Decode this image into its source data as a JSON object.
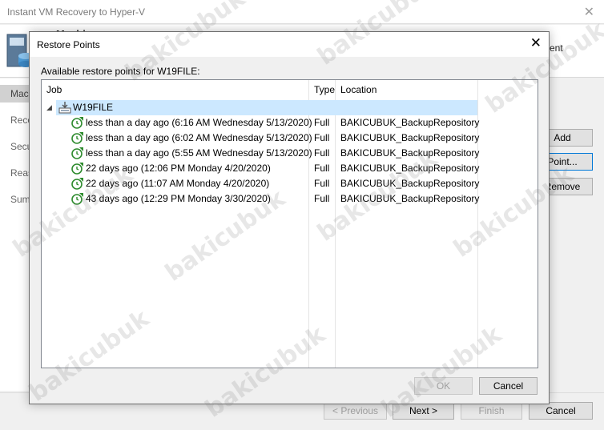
{
  "wizard": {
    "title": "Instant VM Recovery to Hyper-V",
    "header_title": "Machines",
    "header_desc_tail": "ent",
    "steps": [
      "Machines",
      "Recovery Mode",
      "Secure Restore",
      "Reason",
      "Summary"
    ],
    "side_buttons": {
      "add": "Add",
      "point": "Point...",
      "remove": "Remove"
    },
    "footer": {
      "previous": "< Previous",
      "next": "Next >",
      "finish": "Finish",
      "cancel": "Cancel"
    }
  },
  "dialog": {
    "title": "Restore Points",
    "label": "Available restore points for W19FILE:",
    "columns": {
      "job": "Job",
      "type": "Type",
      "location": "Location"
    },
    "root": {
      "name": "W19FILE"
    },
    "rows": [
      {
        "job": "less than a day ago (6:16 AM Wednesday 5/13/2020)",
        "type": "Full",
        "location": "BAKICUBUK_BackupRepository"
      },
      {
        "job": "less than a day ago (6:02 AM Wednesday 5/13/2020)",
        "type": "Full",
        "location": "BAKICUBUK_BackupRepository"
      },
      {
        "job": "less than a day ago (5:55 AM Wednesday 5/13/2020)",
        "type": "Full",
        "location": "BAKICUBUK_BackupRepository"
      },
      {
        "job": "22 days ago (12:06 PM Monday 4/20/2020)",
        "type": "Full",
        "location": "BAKICUBUK_BackupRepository"
      },
      {
        "job": "22 days ago (11:07 AM Monday 4/20/2020)",
        "type": "Full",
        "location": "BAKICUBUK_BackupRepository"
      },
      {
        "job": "43 days ago (12:29 PM Monday 3/30/2020)",
        "type": "Full",
        "location": "BAKICUBUK_BackupRepository"
      }
    ],
    "ok": "OK",
    "cancel": "Cancel"
  },
  "watermark": "bakicubuk",
  "colors": {
    "selection": "#cce8ff",
    "restore_point_icon": "#2e8b2e"
  }
}
